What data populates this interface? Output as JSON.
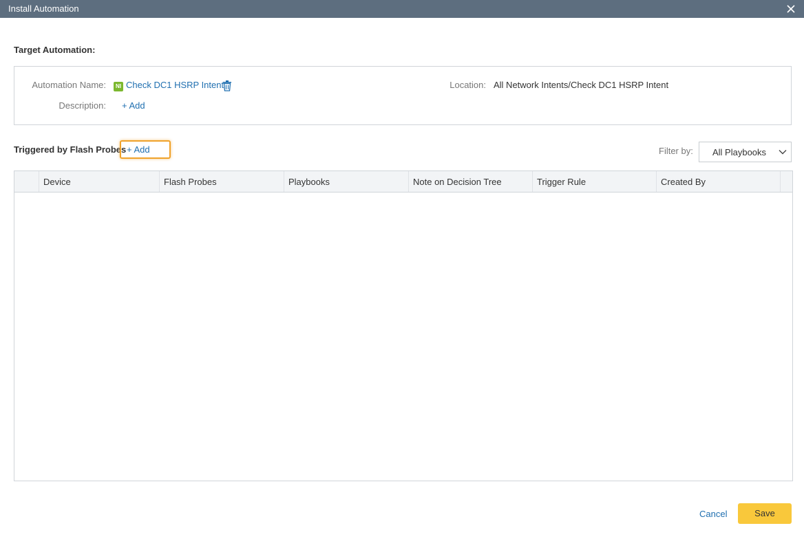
{
  "window": {
    "title": "Install Automation",
    "close_icon": "close-icon"
  },
  "target": {
    "heading": "Target Automation:",
    "automation_name_label": "Automation Name:",
    "badge": "NI",
    "automation_name": "Check DC1 HSRP Intent",
    "description_label": "Description:",
    "description_add": "+ Add",
    "location_label": "Location:",
    "location_value": "All Network Intents/Check DC1 HSRP Intent"
  },
  "trigger": {
    "heading": "Triggered by Flash Probes",
    "add_label": "+ Add",
    "filter_label": "Filter by:",
    "filter_value": "All Playbooks"
  },
  "table": {
    "columns": [
      "Device",
      "Flash Probes",
      "Playbooks",
      "Note on Decision Tree",
      "Trigger Rule",
      "Created By"
    ],
    "rows": []
  },
  "footer": {
    "cancel_label": "Cancel",
    "save_label": "Save"
  },
  "colors": {
    "titlebar": "#5d6e7f",
    "link": "#1f6fb0",
    "highlight": "#f0a22a",
    "save": "#f9c83b",
    "badge": "#7cb82f"
  }
}
